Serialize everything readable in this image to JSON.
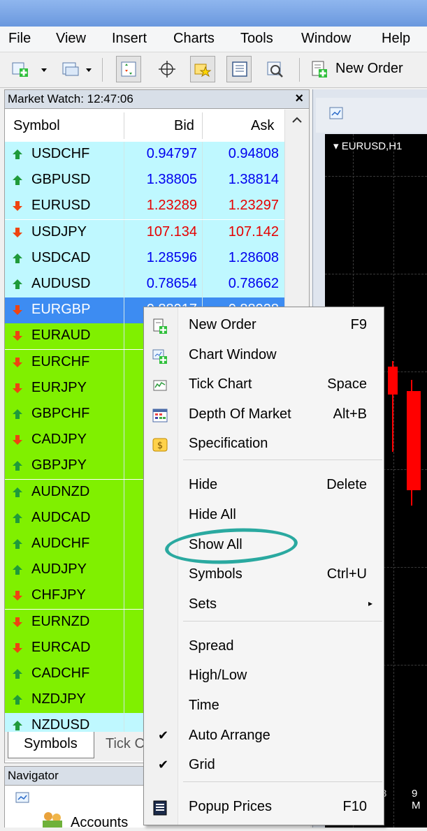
{
  "menubar": [
    "File",
    "View",
    "Insert",
    "Charts",
    "Tools",
    "Window",
    "Help"
  ],
  "toolbar": {
    "new_order_label": "New Order"
  },
  "market_watch": {
    "title": "Market Watch: 12:47:06",
    "close": "×",
    "columns": {
      "symbol": "Symbol",
      "bid": "Bid",
      "ask": "Ask"
    },
    "rows": [
      {
        "symbol": "USDCHF",
        "bid": "0.94797",
        "ask": "0.94808",
        "dir": "up",
        "bg": "#bff8ff",
        "color": "#0000ee"
      },
      {
        "symbol": "GBPUSD",
        "bid": "1.38805",
        "ask": "1.38814",
        "dir": "up",
        "bg": "#bff8ff",
        "color": "#0000ee"
      },
      {
        "symbol": "EURUSD",
        "bid": "1.23289",
        "ask": "1.23297",
        "dir": "down",
        "bg": "#bff8ff",
        "color": "#e60000"
      },
      {
        "symbol": "USDJPY",
        "bid": "107.134",
        "ask": "107.142",
        "dir": "down",
        "bg": "#bff8ff",
        "color": "#e60000"
      },
      {
        "symbol": "USDCAD",
        "bid": "1.28596",
        "ask": "1.28608",
        "dir": "up",
        "bg": "#bff8ff",
        "color": "#0000ee"
      },
      {
        "symbol": "AUDUSD",
        "bid": "0.78654",
        "ask": "0.78662",
        "dir": "up",
        "bg": "#bff8ff",
        "color": "#0000ee"
      },
      {
        "symbol": "EURGBP",
        "bid": "0.88917",
        "ask": "0.88928",
        "dir": "down",
        "bg": "#3d8cf2",
        "color": "#ffffff",
        "selected": true
      },
      {
        "symbol": "EURAUD",
        "bid": "",
        "ask": "",
        "dir": "down",
        "bg": "#80f000",
        "color": "#000000"
      },
      {
        "symbol": "EURCHF",
        "bid": "",
        "ask": "",
        "dir": "down",
        "bg": "#80f000",
        "color": "#000000"
      },
      {
        "symbol": "EURJPY",
        "bid": "",
        "ask": "",
        "dir": "down",
        "bg": "#80f000",
        "color": "#000000"
      },
      {
        "symbol": "GBPCHF",
        "bid": "",
        "ask": "",
        "dir": "up",
        "bg": "#80f000",
        "color": "#000000"
      },
      {
        "symbol": "CADJPY",
        "bid": "",
        "ask": "",
        "dir": "down",
        "bg": "#80f000",
        "color": "#000000"
      },
      {
        "symbol": "GBPJPY",
        "bid": "",
        "ask": "",
        "dir": "up",
        "bg": "#80f000",
        "color": "#000000"
      },
      {
        "symbol": "AUDNZD",
        "bid": "",
        "ask": "",
        "dir": "up",
        "bg": "#80f000",
        "color": "#000000"
      },
      {
        "symbol": "AUDCAD",
        "bid": "",
        "ask": "",
        "dir": "up",
        "bg": "#80f000",
        "color": "#000000"
      },
      {
        "symbol": "AUDCHF",
        "bid": "",
        "ask": "",
        "dir": "up",
        "bg": "#80f000",
        "color": "#000000"
      },
      {
        "symbol": "AUDJPY",
        "bid": "",
        "ask": "",
        "dir": "up",
        "bg": "#80f000",
        "color": "#000000"
      },
      {
        "symbol": "CHFJPY",
        "bid": "",
        "ask": "",
        "dir": "down",
        "bg": "#80f000",
        "color": "#000000"
      },
      {
        "symbol": "EURNZD",
        "bid": "",
        "ask": "",
        "dir": "down",
        "bg": "#80f000",
        "color": "#000000"
      },
      {
        "symbol": "EURCAD",
        "bid": "",
        "ask": "",
        "dir": "down",
        "bg": "#80f000",
        "color": "#000000"
      },
      {
        "symbol": "CADCHF",
        "bid": "",
        "ask": "",
        "dir": "up",
        "bg": "#80f000",
        "color": "#000000"
      },
      {
        "symbol": "NZDJPY",
        "bid": "",
        "ask": "",
        "dir": "up",
        "bg": "#80f000",
        "color": "#000000"
      },
      {
        "symbol": "NZDUSD",
        "bid": "",
        "ask": "",
        "dir": "up",
        "bg": "#bff8ff",
        "color": "#0000ee"
      }
    ],
    "tabs": {
      "symbols": "Symbols",
      "tick": "Tick C"
    }
  },
  "navigator": {
    "title": "Navigator",
    "accounts": "Accounts"
  },
  "chart": {
    "label": "EURUSD,H1",
    "x_label_1": "8",
    "x_label_2": "9 M"
  },
  "context_menu": {
    "items": [
      {
        "label": "New Order",
        "shortcut": "F9",
        "icon": "new-order-icon"
      },
      {
        "label": "Chart Window",
        "shortcut": "",
        "icon": "chart-window-icon"
      },
      {
        "label": "Tick Chart",
        "shortcut": "Space",
        "icon": "tick-chart-icon"
      },
      {
        "label": "Depth Of Market",
        "shortcut": "Alt+B",
        "icon": "depth-of-market-icon"
      },
      {
        "label": "Specification",
        "shortcut": "",
        "icon": "specification-icon"
      },
      {
        "label": "Hide",
        "shortcut": "Delete"
      },
      {
        "label": "Hide All",
        "shortcut": ""
      },
      {
        "label": "Show All",
        "shortcut": ""
      },
      {
        "label": "Symbols",
        "shortcut": "Ctrl+U"
      },
      {
        "label": "Sets",
        "shortcut": "",
        "submenu": true
      },
      {
        "label": "Spread",
        "shortcut": ""
      },
      {
        "label": "High/Low",
        "shortcut": ""
      },
      {
        "label": "Time",
        "shortcut": ""
      },
      {
        "label": "Auto Arrange",
        "shortcut": "",
        "checked": true
      },
      {
        "label": "Grid",
        "shortcut": "",
        "checked": true
      },
      {
        "label": "Popup Prices",
        "shortcut": "F10",
        "icon": "popup-prices-icon"
      }
    ],
    "check_glyph": "✔",
    "submenu_glyph": "▸"
  },
  "colors": {
    "highlight": "#2aa9a0",
    "up_arrow": "#1f9a3a",
    "down_arrow": "#ee4411"
  }
}
